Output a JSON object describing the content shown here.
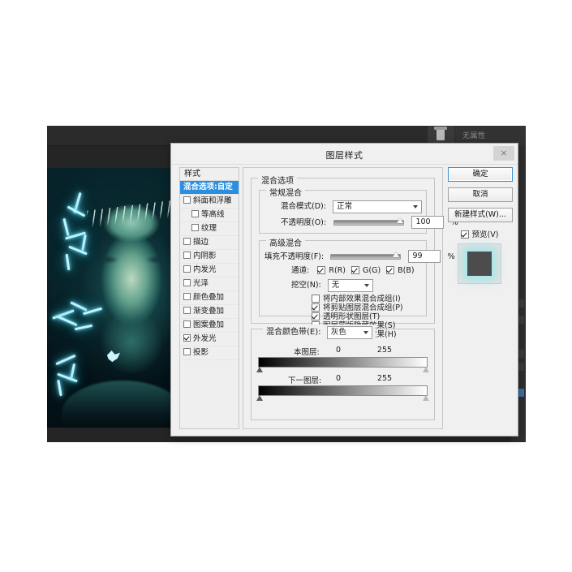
{
  "app": {
    "panel_tab_label": "无属性"
  },
  "dialog": {
    "title": "图层样式",
    "close_label": "×",
    "styles_header": "样式",
    "styles": [
      {
        "label": "混合选项:自定",
        "checkbox": null,
        "selected": true,
        "indent": false
      },
      {
        "label": "斜面和浮雕",
        "checkbox": false,
        "selected": false,
        "indent": false
      },
      {
        "label": "等高线",
        "checkbox": false,
        "selected": false,
        "indent": true
      },
      {
        "label": "纹理",
        "checkbox": false,
        "selected": false,
        "indent": true
      },
      {
        "label": "描边",
        "checkbox": false,
        "selected": false,
        "indent": false
      },
      {
        "label": "内阴影",
        "checkbox": false,
        "selected": false,
        "indent": false
      },
      {
        "label": "内发光",
        "checkbox": false,
        "selected": false,
        "indent": false
      },
      {
        "label": "光泽",
        "checkbox": false,
        "selected": false,
        "indent": false
      },
      {
        "label": "颜色叠加",
        "checkbox": false,
        "selected": false,
        "indent": false
      },
      {
        "label": "渐变叠加",
        "checkbox": false,
        "selected": false,
        "indent": false
      },
      {
        "label": "图案叠加",
        "checkbox": false,
        "selected": false,
        "indent": false
      },
      {
        "label": "外发光",
        "checkbox": true,
        "selected": false,
        "indent": false
      },
      {
        "label": "投影",
        "checkbox": false,
        "selected": false,
        "indent": false
      }
    ],
    "blend_options": {
      "legend": "混合选项",
      "general": {
        "legend": "常规混合",
        "blend_mode_label": "混合模式(D):",
        "blend_mode_value": "正常",
        "opacity_label": "不透明度(O):",
        "opacity_value": "100",
        "opacity_unit": "%"
      },
      "advanced": {
        "legend": "高级混合",
        "fill_opacity_label": "填充不透明度(F):",
        "fill_opacity_value": "99",
        "fill_opacity_unit": "%",
        "channels_label": "通道:",
        "channels": [
          {
            "label": "R(R)",
            "checked": true
          },
          {
            "label": "G(G)",
            "checked": true
          },
          {
            "label": "B(B)",
            "checked": true
          }
        ],
        "knockout_label": "挖空(N):",
        "knockout_value": "无",
        "options": [
          {
            "label": "将内部效果混合成组(I)",
            "checked": false
          },
          {
            "label": "将剪贴图层混合成组(P)",
            "checked": true
          },
          {
            "label": "透明形状图层(T)",
            "checked": true
          },
          {
            "label": "图层蒙版隐藏效果(S)",
            "checked": false
          },
          {
            "label": "矢量蒙版隐藏效果(H)",
            "checked": false
          }
        ]
      },
      "blend_if": {
        "label": "混合颜色带(E):",
        "value": "灰色",
        "this_layer": {
          "label": "本图层:",
          "min": "0",
          "max": "255"
        },
        "underlying_layer": {
          "label": "下一图层:",
          "min": "0",
          "max": "255"
        }
      }
    },
    "buttons": {
      "ok": "确定",
      "cancel": "取消",
      "new_style": "新建样式(W)...",
      "preview_label": "预览(V)",
      "preview_checked": true
    }
  },
  "colors": {
    "accent": "#2a8fe0",
    "dialog_bg": "#f0f0f0",
    "app_bg": "#252525",
    "glow": "#8ce1e6"
  }
}
